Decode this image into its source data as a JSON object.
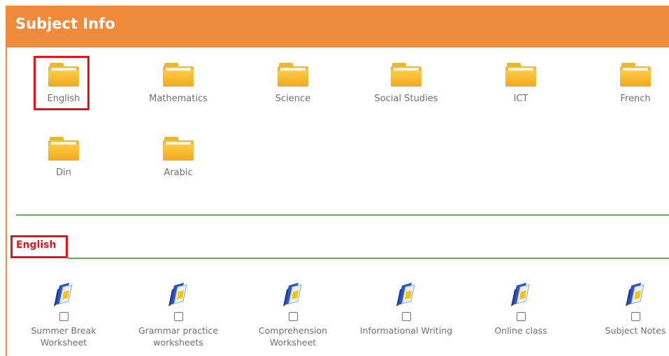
{
  "header": {
    "title": "Subject Info"
  },
  "subjects": [
    {
      "label": "English"
    },
    {
      "label": "Mathematics"
    },
    {
      "label": "Science"
    },
    {
      "label": "Social Studies"
    },
    {
      "label": "ICT"
    },
    {
      "label": "French"
    },
    {
      "label": "Din"
    },
    {
      "label": "Arabic"
    }
  ],
  "selected_subject": {
    "title": "English"
  },
  "documents": [
    {
      "line1": "Summer Break",
      "line2": "Worksheet"
    },
    {
      "line1": "Grammar practice",
      "line2": "worksheets"
    },
    {
      "line1": "Comprehension",
      "line2": "Worksheet"
    },
    {
      "line1": "Informational Writing",
      "line2": ""
    },
    {
      "line1": "Online class",
      "line2": ""
    },
    {
      "line1": "Subject Notes",
      "line2": ""
    }
  ],
  "colors": {
    "header": "#ee8a3a",
    "highlight": "#e3121b",
    "divider": "#6aa95a",
    "folder": "#f0b83a"
  }
}
